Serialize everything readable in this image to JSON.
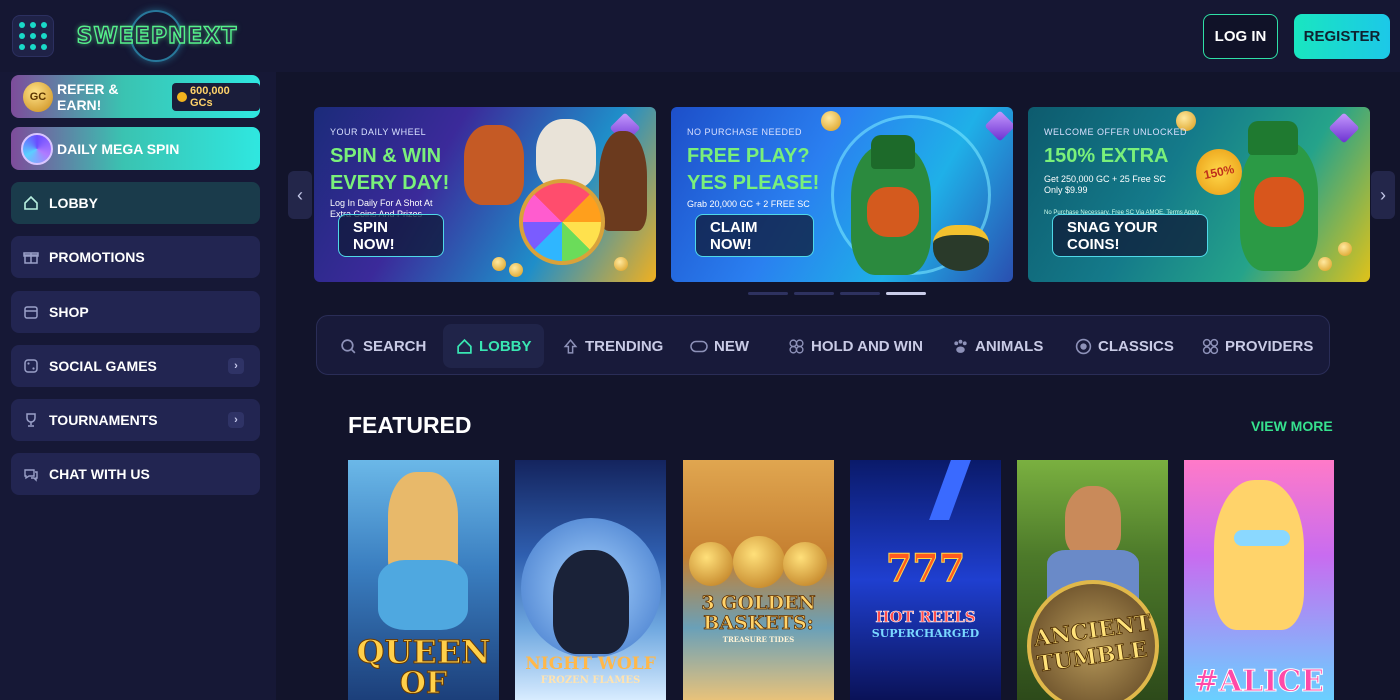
{
  "header": {
    "logo_text": "SWEEPNEXT",
    "login_label": "LOG IN",
    "register_label": "REGISTER"
  },
  "sidebar": {
    "refer": {
      "label": "REFER & EARN!",
      "badge": "600,000 GCs"
    },
    "mega_spin": {
      "label": "DAILY MEGA SPIN"
    },
    "items": [
      {
        "label": "LOBBY",
        "icon": "home-icon",
        "active": true
      },
      {
        "label": "PROMOTIONS",
        "icon": "gift-icon"
      },
      {
        "label": "SHOP",
        "icon": "store-icon"
      },
      {
        "label": "SOCIAL GAMES",
        "icon": "dice-icon",
        "has_submenu": true
      },
      {
        "label": "TOURNAMENTS",
        "icon": "trophy-icon",
        "has_submenu": true
      },
      {
        "label": "CHAT WITH US",
        "icon": "chat-icon"
      }
    ]
  },
  "banners": [
    {
      "tag": "YOUR DAILY WHEEL",
      "headline_1": "SPIN & WIN",
      "headline_2": "EVERY DAY!",
      "sub_1": "Log In Daily For A Shot At",
      "sub_2": "Extra Coins And Prizes",
      "cta": "SPIN NOW!"
    },
    {
      "tag": "NO PURCHASE NEEDED",
      "headline_1": "FREE PLAY?",
      "headline_2": "YES PLEASE!",
      "sub_1": "Grab 20,000 GC + 2 FREE SC",
      "cta": "CLAIM NOW!"
    },
    {
      "tag": "WELCOME OFFER UNLOCKED",
      "headline_1": "150% EXTRA",
      "sub_1": "Get 250,000 GC + 25 Free SC",
      "sub_2": "Only $9.99",
      "fine_print": "No Purchase Necessary. Free SC Via AMOE. Terms Apply",
      "badge": "150%",
      "cta": "SNAG YOUR COINS!"
    }
  ],
  "carousel": {
    "active_index": 3,
    "count": 4
  },
  "categories": [
    {
      "label": "SEARCH",
      "icon": "search-icon"
    },
    {
      "label": "LOBBY",
      "icon": "home-icon",
      "active": true
    },
    {
      "label": "TRENDING",
      "icon": "trending-icon"
    },
    {
      "label": "NEW",
      "icon": "new-icon"
    },
    {
      "label": "HOLD AND WIN",
      "icon": "clover-icon"
    },
    {
      "label": "ANIMALS",
      "icon": "paw-icon"
    },
    {
      "label": "CLASSICS",
      "icon": "classics-icon"
    },
    {
      "label": "PROVIDERS",
      "icon": "providers-icon"
    }
  ],
  "featured": {
    "title": "FEATURED",
    "view_more": "VIEW MORE",
    "games": [
      {
        "title_1": "QUEEN",
        "title_2": "OF"
      },
      {
        "title_1": "NIGHT WOLF",
        "title_2": "FROZEN FLAMES"
      },
      {
        "title_1": "3 GOLDEN",
        "title_2": "BASKETS:",
        "title_3": "TREASURE TIDES"
      },
      {
        "title_1": "HOT REELS",
        "title_2": "SUPERCHARGED"
      },
      {
        "title_1": "ANCIENT",
        "title_2": "TUMBLE"
      },
      {
        "title_1": "#ALICE"
      }
    ]
  },
  "colors": {
    "background": "#12142b",
    "accent_green": "#36e28e",
    "accent_teal": "#19e6c0"
  }
}
